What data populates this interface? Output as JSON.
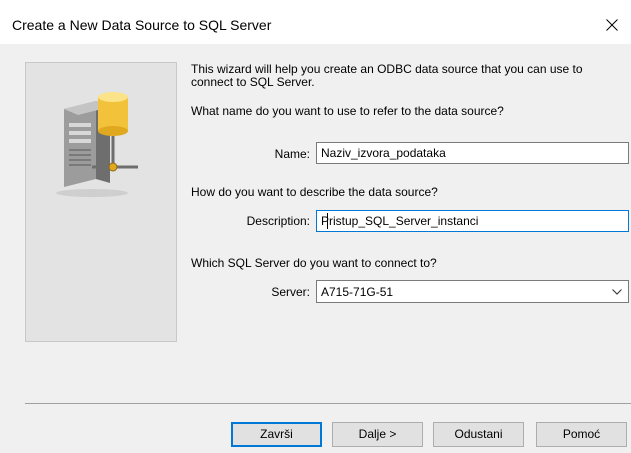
{
  "window": {
    "title": "Create a New Data Source to SQL Server"
  },
  "intro": {
    "text": "This wizard will help you create an ODBC data source that you can use to connect to SQL Server."
  },
  "name_section": {
    "question": "What name do you want to use to refer to the data source?",
    "label": "Name:",
    "value": "Naziv_izvora_podataka"
  },
  "description_section": {
    "question": "How do you want to describe the data source?",
    "label": "Description:",
    "value": "Pristup_SQL_Server_instanci"
  },
  "server_section": {
    "question": "Which SQL Server do you want to connect to?",
    "label": "Server:",
    "value": "A715-71G-51"
  },
  "buttons": {
    "finish": "Završi",
    "next": "Dalje >",
    "cancel": "Odustani",
    "help": "Pomoć"
  },
  "icons": {
    "close": "close-icon",
    "wizard": "database-server-icon",
    "dropdown": "chevron-down-icon"
  },
  "colors": {
    "focus_border": "#0078d7",
    "dialog_bg": "#f0f0f0"
  }
}
